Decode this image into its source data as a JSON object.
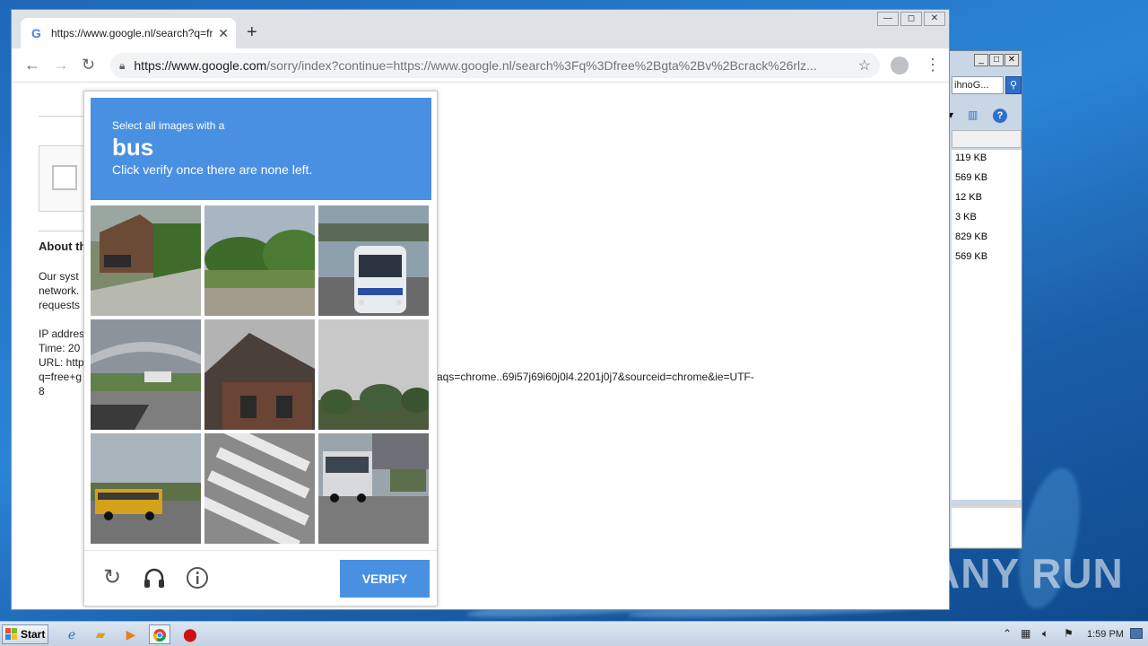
{
  "browser": {
    "tab_title": "https://www.google.nl/search?q=fre",
    "tab_close": "✕",
    "new_tab": "+",
    "url_host": "https://www.google.com",
    "url_rest": "/sorry/index?continue=https://www.google.nl/search%3Fq%3Dfree%2Bgta%2Bv%2Bcrack%26rlz...",
    "win_min": "—",
    "win_max": "◻",
    "win_close": "✕"
  },
  "page": {
    "about_heading": "About th",
    "body_lines": [
      "Our syst",
      "network.",
      "requests"
    ],
    "ip_line": "IP addres",
    "time_line": "Time: 20",
    "url_line": "URL: http",
    "url_cont": "q=free+g",
    "url_tail": "aqs=chrome..69i57j69i60j0l4.2201j0j7&sourceid=chrome&ie=UTF-",
    "url_end": "8"
  },
  "captcha": {
    "instruction_prefix": "Select all images with a",
    "target": "bus",
    "instruction_suffix": "Click verify once there are none left.",
    "verify_label": "VERIFY",
    "tiles": [
      {
        "name": "tile-house-yard"
      },
      {
        "name": "tile-trees-lawn"
      },
      {
        "name": "tile-bus-front"
      },
      {
        "name": "tile-overpass"
      },
      {
        "name": "tile-roof"
      },
      {
        "name": "tile-trees-sky"
      },
      {
        "name": "tile-school-bus"
      },
      {
        "name": "tile-crosswalk"
      },
      {
        "name": "tile-bus-street"
      }
    ]
  },
  "explorer": {
    "search_text": "ihnoG...",
    "sizes": [
      "119 KB",
      "569 KB",
      "12 KB",
      "3 KB",
      "829 KB",
      "569 KB"
    ]
  },
  "taskbar": {
    "start_label": "Start",
    "clock": "1:59 PM"
  },
  "watermark": "ANY RUN"
}
